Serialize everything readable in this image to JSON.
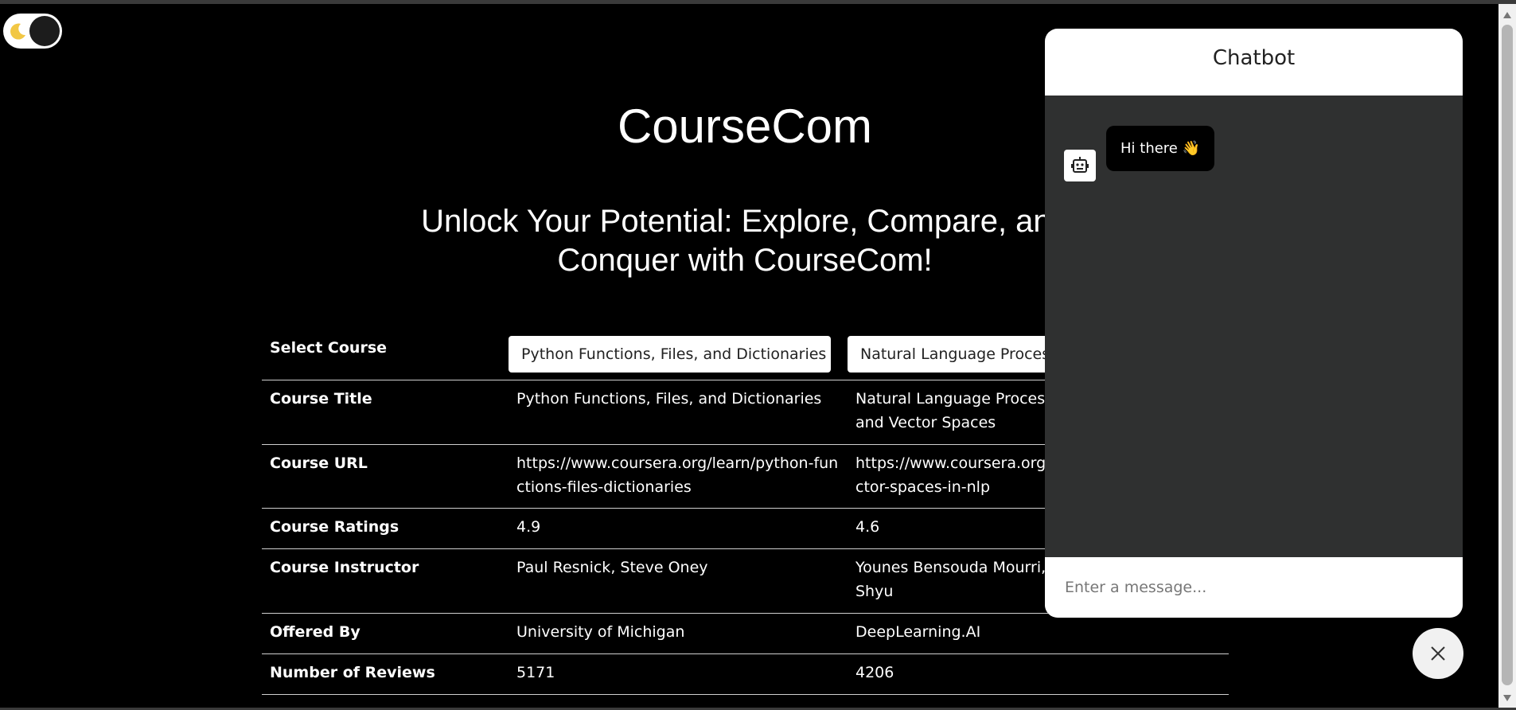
{
  "app": {
    "title": "CourseCom",
    "subtitle": "Unlock Your Potential: Explore, Compare, and Conquer with CourseCom!"
  },
  "theme_toggle": {
    "icon": "moon-icon",
    "mode": "dark"
  },
  "comparison": {
    "select_label": "Select Course",
    "selected": [
      "Python Functions, Files, and Dictionaries",
      "Natural Language Processing with Classification and Vector Spaces"
    ],
    "rows": [
      {
        "label": "Course Title",
        "values": [
          "Python Functions, Files, and Dictionaries",
          "Natural Language Processing with Classification and Vector Spaces"
        ]
      },
      {
        "label": "Course URL",
        "values": [
          "https://www.coursera.org/learn/python-functions-files-dictionaries",
          "https://www.coursera.org/learn/classification-vector-spaces-in-nlp"
        ]
      },
      {
        "label": "Course Ratings",
        "values": [
          "4.9",
          "4.6"
        ]
      },
      {
        "label": "Course Instructor",
        "values": [
          "Paul Resnick, Steve Oney",
          "Younes Bensouda Mourri, Łukasz Kaiser, Eddy Shyu"
        ]
      },
      {
        "label": "Offered By",
        "values": [
          "University of Michigan",
          "DeepLearning.AI"
        ]
      },
      {
        "label": "Number of Reviews",
        "values": [
          "5171",
          "4206"
        ]
      }
    ]
  },
  "chatbot": {
    "header": "Chatbot",
    "messages": [
      {
        "from": "bot",
        "text": "Hi there 👋"
      }
    ],
    "input_placeholder": "Enter a message..."
  },
  "colors": {
    "background": "#000000",
    "chat_body": "#2f3030",
    "chat_bubble": "#000000",
    "moon": "#f2c744"
  }
}
